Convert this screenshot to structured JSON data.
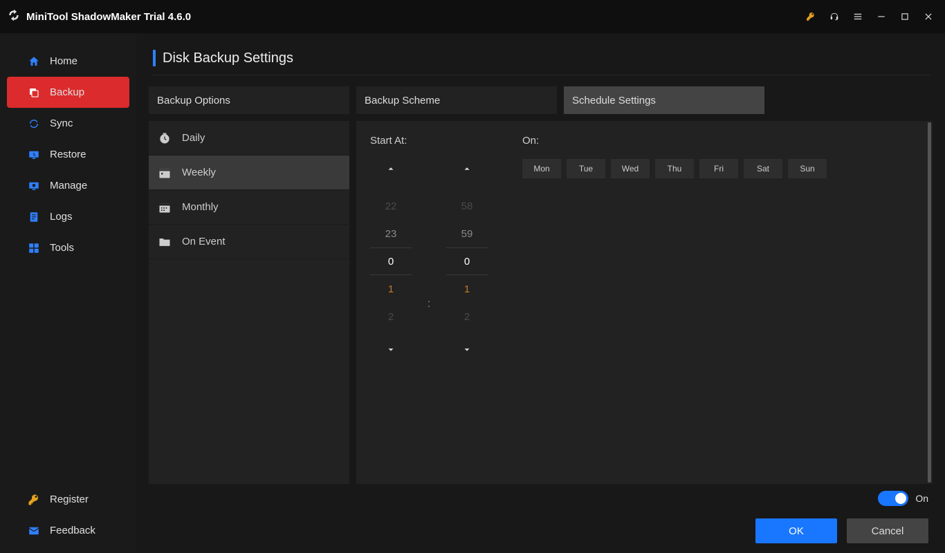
{
  "titlebar": {
    "title": "MiniTool ShadowMaker Trial 4.6.0"
  },
  "sidebar": {
    "items": [
      {
        "label": "Home"
      },
      {
        "label": "Backup"
      },
      {
        "label": "Sync"
      },
      {
        "label": "Restore"
      },
      {
        "label": "Manage"
      },
      {
        "label": "Logs"
      },
      {
        "label": "Tools"
      }
    ],
    "bottom": [
      {
        "label": "Register"
      },
      {
        "label": "Feedback"
      }
    ]
  },
  "page": {
    "title": "Disk Backup Settings"
  },
  "tabs": {
    "options": "Backup Options",
    "scheme": "Backup Scheme",
    "schedule": "Schedule Settings"
  },
  "schedule": {
    "modes": {
      "daily": "Daily",
      "weekly": "Weekly",
      "monthly": "Monthly",
      "onevent": "On Event"
    },
    "start_label": "Start At:",
    "on_label": "On:",
    "hours": {
      "m2": "22",
      "m1": "23",
      "sel": "0",
      "p1": "1",
      "p2": "2"
    },
    "minutes": {
      "m2": "58",
      "m1": "59",
      "sel": "0",
      "p1": "1",
      "p2": "2"
    },
    "colon": ":",
    "days": {
      "mon": "Mon",
      "tue": "Tue",
      "wed": "Wed",
      "thu": "Thu",
      "fri": "Fri",
      "sat": "Sat",
      "sun": "Sun"
    }
  },
  "footer": {
    "toggle_label": "On",
    "ok": "OK",
    "cancel": "Cancel"
  }
}
